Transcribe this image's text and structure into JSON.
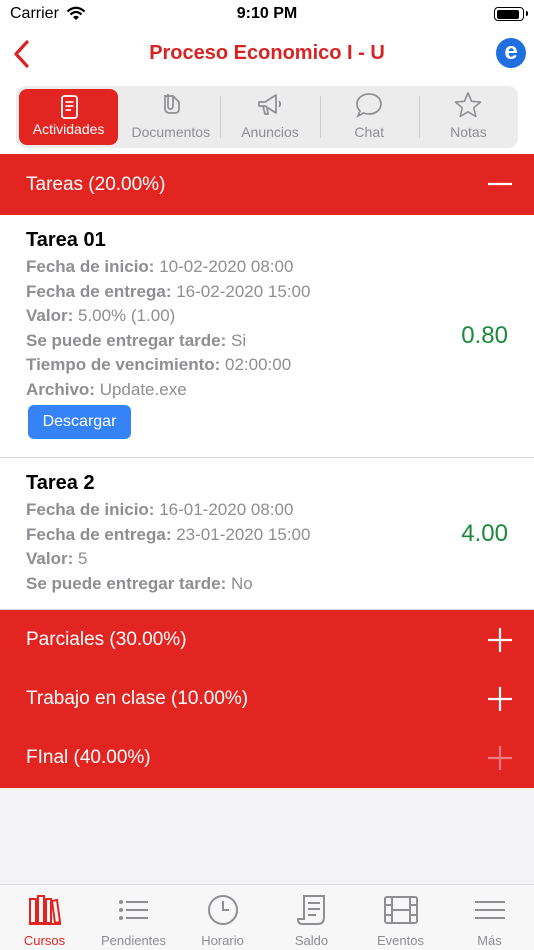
{
  "status": {
    "carrier": "Carrier",
    "time": "9:10 PM"
  },
  "nav": {
    "title": "Proceso Economico I - U",
    "brand_letter": "e"
  },
  "tabs": [
    {
      "label": "Actividades",
      "icon": "document-icon",
      "active": true
    },
    {
      "label": "Documentos",
      "icon": "paperclip-icon",
      "active": false
    },
    {
      "label": "Anuncios",
      "icon": "megaphone-icon",
      "active": false
    },
    {
      "label": "Chat",
      "icon": "chat-bubble-icon",
      "active": false
    },
    {
      "label": "Notas",
      "icon": "star-icon",
      "active": false
    }
  ],
  "sections": {
    "tareas": {
      "label": "Tareas (20.00%)",
      "expanded": true
    },
    "parciales": {
      "label": "Parciales (30.00%)",
      "expanded": false
    },
    "trabajo": {
      "label": "Trabajo en clase (10.00%)",
      "expanded": false
    },
    "final": {
      "label": "FInal (40.00%)",
      "expanded": false
    }
  },
  "tasks": [
    {
      "title": "Tarea 01",
      "fields": [
        {
          "label": "Fecha de inicio:",
          "value": " 10-02-2020 08:00"
        },
        {
          "label": "Fecha de entrega:",
          "value": " 16-02-2020 15:00"
        },
        {
          "label": "Valor:",
          "value": " 5.00% (1.00)"
        },
        {
          "label": "Se puede entregar tarde:",
          "value": " Si"
        },
        {
          "label": "Tiempo de vencimiento:",
          "value": " 02:00:00"
        },
        {
          "label": "Archivo:",
          "value": " Update.exe"
        }
      ],
      "grade": "0.80",
      "button": "Descargar"
    },
    {
      "title": "Tarea 2",
      "fields": [
        {
          "label": "Fecha de inicio:",
          "value": " 16-01-2020 08:00"
        },
        {
          "label": "Fecha de entrega:",
          "value": " 23-01-2020 15:00"
        },
        {
          "label": "Valor:",
          "value": " 5"
        },
        {
          "label": "Se puede entregar tarde:",
          "value": " No"
        }
      ],
      "grade": "4.00"
    }
  ],
  "tabbar": [
    {
      "label": "Cursos",
      "icon": "books-icon",
      "active": true
    },
    {
      "label": "Pendientes",
      "icon": "list-icon",
      "active": false
    },
    {
      "label": "Horario",
      "icon": "clock-icon",
      "active": false
    },
    {
      "label": "Saldo",
      "icon": "receipt-icon",
      "active": false
    },
    {
      "label": "Eventos",
      "icon": "film-icon",
      "active": false
    },
    {
      "label": "Más",
      "icon": "menu-icon",
      "active": false
    }
  ],
  "colors": {
    "accent": "#e32521",
    "grade": "#1a8a3a",
    "button": "#3583f6",
    "brand": "#1f6fe0"
  }
}
